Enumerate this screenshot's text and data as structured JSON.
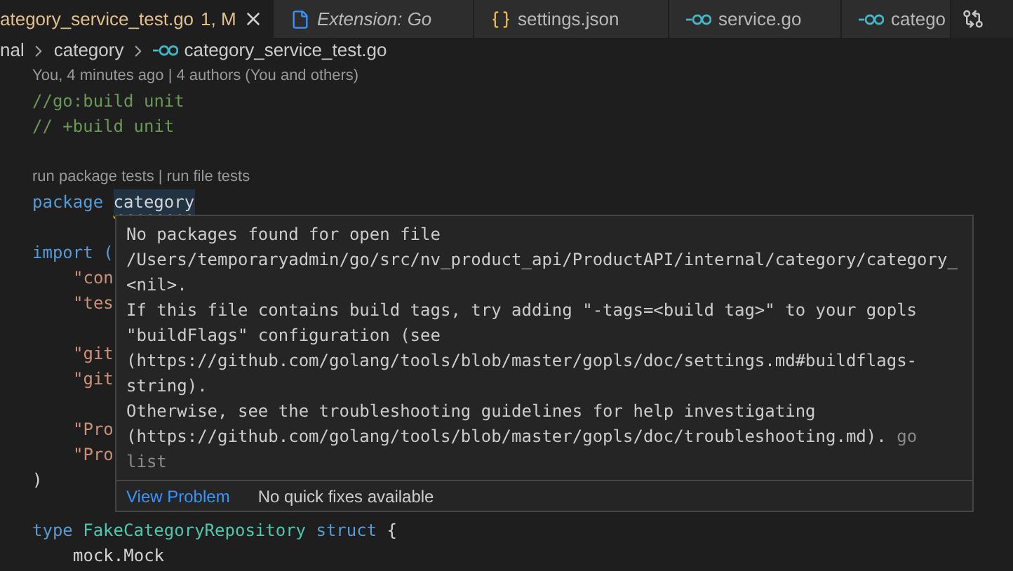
{
  "tabs": [
    {
      "label": "ategory_service_test.go",
      "status": "1, M",
      "italic": false,
      "selected": true
    },
    {
      "label": "Extension: Go",
      "kind": "file",
      "italic": true,
      "selected": false
    },
    {
      "label": "settings.json",
      "kind": "braces",
      "italic": false,
      "selected": false
    },
    {
      "label": "service.go",
      "kind": "go",
      "italic": false,
      "selected": false
    },
    {
      "label": "catego",
      "kind": "go",
      "italic": false,
      "selected": false
    }
  ],
  "breadcrumbs": [
    "nal",
    "category",
    "category_service_test.go"
  ],
  "code_lines": [
    {
      "kind": "codelens",
      "text": "You, 4 minutes ago | 4 authors (You and others)"
    },
    {
      "kind": "code",
      "indent": false,
      "tokens": [
        {
          "text": "//go:build unit",
          "kind": "comment"
        }
      ]
    },
    {
      "kind": "code",
      "indent": false,
      "tokens": [
        {
          "text": "// +build unit",
          "kind": "comment"
        }
      ]
    },
    {
      "kind": "blank"
    },
    {
      "kind": "codelens",
      "text": "run package tests | run file tests"
    },
    {
      "kind": "code",
      "indent": false,
      "tokens": [
        {
          "text": "package",
          "kind": "keyword"
        },
        {
          "text": "category",
          "kind": "error"
        }
      ]
    },
    {
      "kind": "blank"
    },
    {
      "kind": "code",
      "indent": false,
      "tokens": [
        {
          "text": "import (",
          "kind": "keyword"
        }
      ]
    },
    {
      "kind": "code",
      "indent": true,
      "tokens": [
        {
          "text": "\"con",
          "kind": "string"
        }
      ]
    },
    {
      "kind": "code",
      "indent": true,
      "tokens": [
        {
          "text": "\"tes",
          "kind": "string"
        }
      ]
    },
    {
      "kind": "blank"
    },
    {
      "kind": "code",
      "indent": true,
      "tokens": [
        {
          "text": "\"git",
          "kind": "string"
        }
      ]
    },
    {
      "kind": "code",
      "indent": true,
      "tokens": [
        {
          "text": "\"git",
          "kind": "string"
        }
      ]
    },
    {
      "kind": "blank"
    },
    {
      "kind": "code",
      "indent": true,
      "tokens": [
        {
          "text": "\"Pro",
          "kind": "string"
        }
      ]
    },
    {
      "kind": "code",
      "indent": true,
      "tokens": [
        {
          "text": "\"Pro",
          "kind": "string"
        }
      ]
    },
    {
      "kind": "code",
      "indent": false,
      "tokens": [
        {
          "text": ")",
          "kind": "plain"
        }
      ]
    },
    {
      "kind": "blank"
    },
    {
      "kind": "code",
      "indent": false,
      "tokens": [
        {
          "text": "type",
          "kind": "keyword"
        },
        {
          "text": "FakeCategoryRepository",
          "kind": "type"
        },
        {
          "text": "struct",
          "kind": "keyword"
        },
        {
          "text": "{",
          "kind": "plain"
        }
      ]
    },
    {
      "kind": "code",
      "indent": true,
      "tokens": [
        {
          "text": "mock.Mock",
          "kind": "plain"
        }
      ]
    }
  ],
  "hover": {
    "lines": [
      "No packages found for open file",
      "/Users/temporaryadmin/go/src/nv_product_api/ProductAPI/internal/category/category_",
      "<nil>.",
      "If this file contains build tags, try adding \"-tags=<build tag>\" to your gopls",
      "\"buildFlags\" configuration (see",
      "(https://github.com/golang/tools/blob/master/gopls/doc/settings.md#buildflags-",
      "string).",
      "Otherwise, see the troubleshooting guidelines for help investigating",
      "(https://github.com/golang/tools/blob/master/gopls/doc/troubleshooting.md)."
    ],
    "source": "go list",
    "action": "View Problem",
    "note": "No quick fixes available"
  }
}
